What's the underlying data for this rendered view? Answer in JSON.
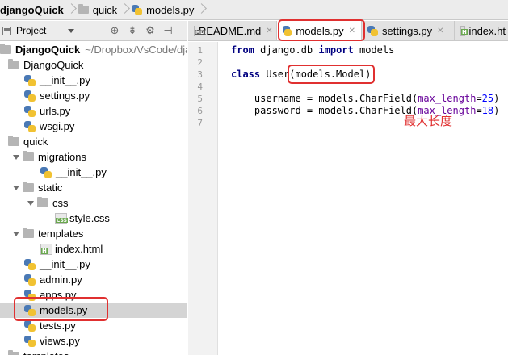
{
  "breadcrumb": {
    "items": [
      {
        "label": "djangoQuick",
        "icon": "folder-icon"
      },
      {
        "label": "quick",
        "icon": "folder-icon"
      },
      {
        "label": "models.py",
        "icon": "python-file-icon"
      }
    ]
  },
  "project_panel": {
    "title": "Project"
  },
  "tree": [
    {
      "label": "DjangoQuick",
      "extra": "~/Dropbox/VsCode/dja",
      "kind": "root"
    },
    {
      "label": "DjangoQuick",
      "kind": "dir"
    },
    {
      "label": "__init__.py",
      "kind": "py"
    },
    {
      "label": "settings.py",
      "kind": "py"
    },
    {
      "label": "urls.py",
      "kind": "py"
    },
    {
      "label": "wsgi.py",
      "kind": "py"
    },
    {
      "label": "quick",
      "kind": "dir"
    },
    {
      "label": "migrations",
      "kind": "dir"
    },
    {
      "label": "__init__.py",
      "kind": "py"
    },
    {
      "label": "static",
      "kind": "dir"
    },
    {
      "label": "css",
      "kind": "dir"
    },
    {
      "label": "style.css",
      "kind": "css"
    },
    {
      "label": "templates",
      "kind": "dir"
    },
    {
      "label": "index.html",
      "kind": "html"
    },
    {
      "label": "__init__.py",
      "kind": "py"
    },
    {
      "label": "admin.py",
      "kind": "py"
    },
    {
      "label": "apps.py",
      "kind": "py"
    },
    {
      "label": "models.py",
      "kind": "py"
    },
    {
      "label": "tests.py",
      "kind": "py"
    },
    {
      "label": "views.py",
      "kind": "py"
    },
    {
      "label": "templates",
      "kind": "dir"
    }
  ],
  "tabs": [
    {
      "label": "README.md",
      "icon": "markdown-file-icon"
    },
    {
      "label": "models.py",
      "icon": "python-file-icon",
      "active": true
    },
    {
      "label": "settings.py",
      "icon": "python-file-icon"
    },
    {
      "label": "index.ht",
      "icon": "html-file-icon"
    }
  ],
  "editor": {
    "line_numbers": [
      "1",
      "2",
      "3",
      "4",
      "5",
      "6",
      "7"
    ],
    "code": {
      "l1_kw1": "from",
      "l1_mod": " django.db ",
      "l1_kw2": "import",
      "l1_rest": " models",
      "l3_kw": "class",
      "l3_rest": " User(models.Model):",
      "l5_pre": "    username = models.CharField(",
      "l5_param": "max_length",
      "l5_eq": "=",
      "l5_num": "25",
      "l5_end": ")",
      "l6_pre": "    password = models.CharField(",
      "l6_param": "max_length",
      "l6_eq": "=",
      "l6_num": "18",
      "l6_end": ")"
    }
  },
  "annotation": {
    "text": "最大长度",
    "color": "#e03030"
  }
}
